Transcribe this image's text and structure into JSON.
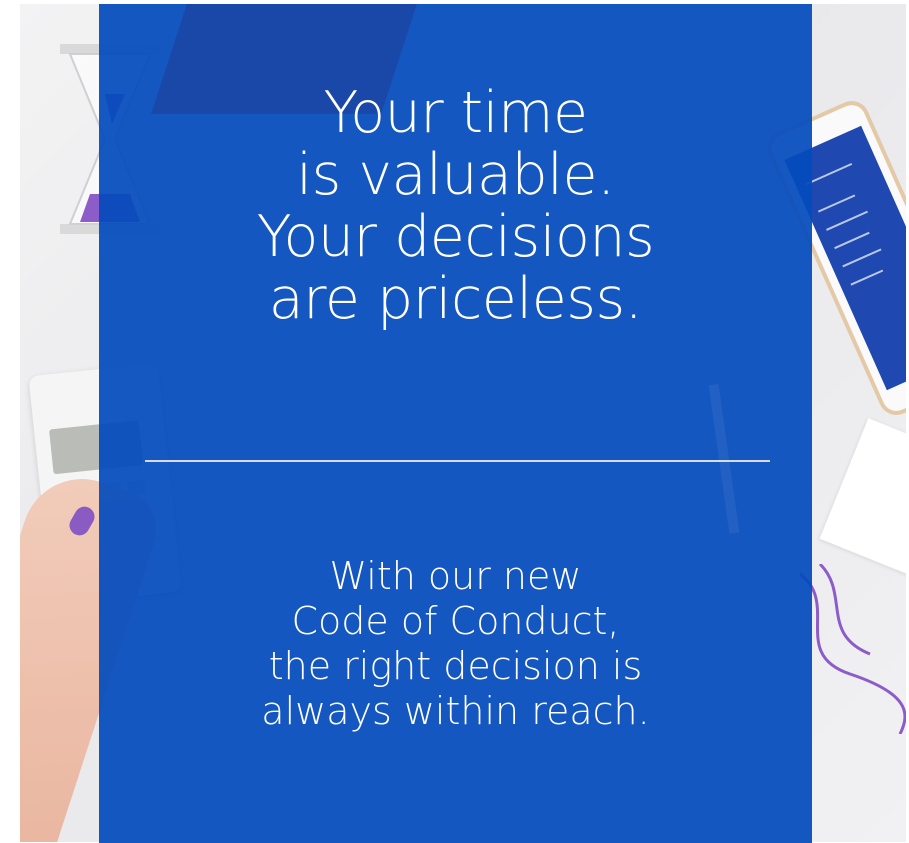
{
  "headline": {
    "lines": [
      "Your time",
      "is valuable.",
      "Your decisions",
      "are priceless."
    ]
  },
  "subline": {
    "lines": [
      "With our new",
      "Code of Conduct,",
      "the right decision is",
      "always within reach."
    ]
  },
  "colors": {
    "panel_blue": "#0449BC",
    "text": "#FFFFFF",
    "divider": "#D7DCEC",
    "nail_purple": "#8A5BC2"
  },
  "icons": [
    "hourglass-icon",
    "calculator-icon",
    "phone-icon"
  ]
}
